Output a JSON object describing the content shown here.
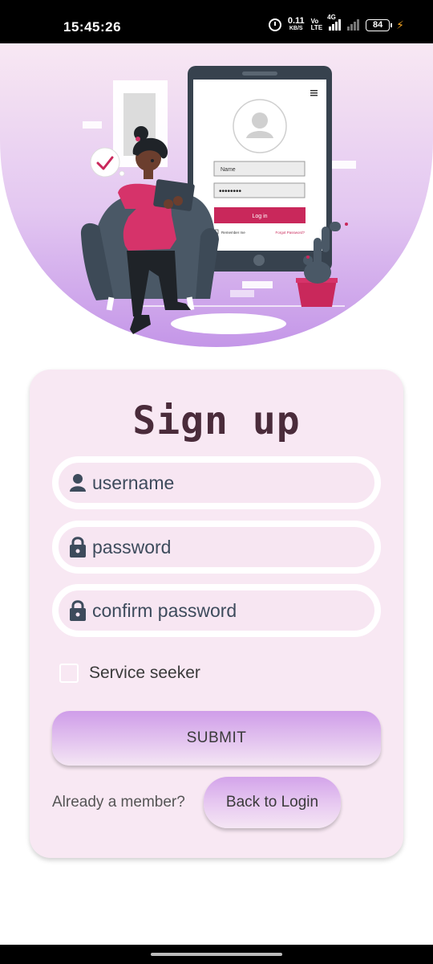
{
  "status_bar": {
    "time": "15:45:26",
    "net_speed_value": "0.11",
    "net_speed_unit": "KB/S",
    "volte_top": "Vo",
    "volte_bottom": "LTE",
    "network_type": "4G",
    "battery": "84"
  },
  "illustration": {
    "field_name": "Name",
    "field_password": "••••••••",
    "login_label": "Log in",
    "remember_label": "Remember me",
    "forgot_label": "Forgot Password?",
    "colors": {
      "sky_top": "#f8e8f3",
      "sky_bottom": "#c496e8",
      "accent": "#c9285b"
    }
  },
  "form": {
    "title": "Sign up",
    "username_placeholder": "username",
    "password_placeholder": "password",
    "confirm_placeholder": "confirm password",
    "checkbox_label": "Service seeker",
    "submit_label": "SUBMIT",
    "member_text": "Already a member?",
    "login_label": "Back to Login"
  },
  "icons": {
    "username": "person-icon",
    "password": "lock-icon",
    "confirm": "lock-icon"
  }
}
